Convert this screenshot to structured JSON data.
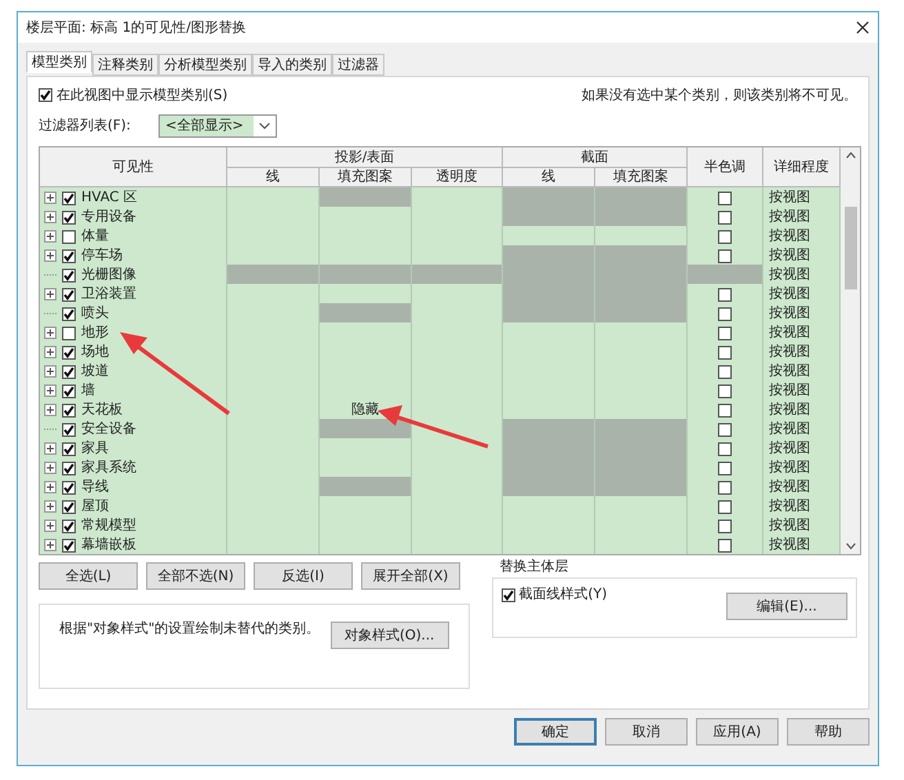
{
  "window": {
    "title": "楼层平面: 标高 1的可见性/图形替换"
  },
  "tabs": [
    {
      "label": "模型类别",
      "selected": true
    },
    {
      "label": "注释类别",
      "selected": false
    },
    {
      "label": "分析模型类别",
      "selected": false
    },
    {
      "label": "导入的类别",
      "selected": false
    },
    {
      "label": "过滤器",
      "selected": false
    }
  ],
  "show_categories": {
    "label": "在此视图中显示模型类别(S)",
    "checked": true
  },
  "hint": "如果没有选中某个类别，则该类别将不可见。",
  "filter": {
    "label": "过滤器列表(F):",
    "value": "<全部显示>"
  },
  "table": {
    "header": {
      "visibility": "可见性",
      "projection": "投影/表面",
      "cut": "截面",
      "halftone": "半色调",
      "detail": "详细程度",
      "projection_columns": [
        "线",
        "填充图案",
        "透明度"
      ],
      "cut_columns": [
        "线",
        "填充图案"
      ]
    },
    "rows": [
      {
        "name": "HVAC 区",
        "checked": true,
        "expandable": true,
        "cells": [
          {
            "disabled": false
          },
          {
            "disabled": true
          },
          {
            "disabled": false
          },
          {
            "disabled": true
          },
          {
            "disabled": true
          }
        ],
        "halftone": {
          "disabled": false,
          "checked": false
        },
        "detail": "按视图"
      },
      {
        "name": "专用设备",
        "checked": true,
        "expandable": true,
        "cells": [
          {
            "disabled": false
          },
          {
            "disabled": false
          },
          {
            "disabled": false
          },
          {
            "disabled": true
          },
          {
            "disabled": true
          }
        ],
        "halftone": {
          "disabled": false,
          "checked": false
        },
        "detail": "按视图"
      },
      {
        "name": "体量",
        "checked": false,
        "expandable": true,
        "cells": [
          {
            "disabled": false
          },
          {
            "disabled": false
          },
          {
            "disabled": false
          },
          {
            "disabled": false
          },
          {
            "disabled": false
          }
        ],
        "halftone": {
          "disabled": false,
          "checked": false
        },
        "detail": "按视图"
      },
      {
        "name": "停车场",
        "checked": true,
        "expandable": true,
        "cells": [
          {
            "disabled": false
          },
          {
            "disabled": false
          },
          {
            "disabled": false
          },
          {
            "disabled": true
          },
          {
            "disabled": true
          }
        ],
        "halftone": {
          "disabled": false,
          "checked": false
        },
        "detail": "按视图"
      },
      {
        "name": "光栅图像",
        "checked": true,
        "expandable": false,
        "cells": [
          {
            "disabled": true
          },
          {
            "disabled": true
          },
          {
            "disabled": true
          },
          {
            "disabled": true
          },
          {
            "disabled": true
          }
        ],
        "halftone": {
          "disabled": true
        },
        "detail": "按视图"
      },
      {
        "name": "卫浴装置",
        "checked": true,
        "expandable": true,
        "cells": [
          {
            "disabled": false
          },
          {
            "disabled": false
          },
          {
            "disabled": false
          },
          {
            "disabled": true
          },
          {
            "disabled": true
          }
        ],
        "halftone": {
          "disabled": false,
          "checked": false
        },
        "detail": "按视图"
      },
      {
        "name": "喷头",
        "checked": true,
        "expandable": false,
        "cells": [
          {
            "disabled": false
          },
          {
            "disabled": true
          },
          {
            "disabled": false
          },
          {
            "disabled": true
          },
          {
            "disabled": true
          }
        ],
        "halftone": {
          "disabled": false,
          "checked": false
        },
        "detail": "按视图"
      },
      {
        "name": "地形",
        "checked": false,
        "expandable": true,
        "cells": [
          {
            "disabled": false
          },
          {
            "disabled": false
          },
          {
            "disabled": false
          },
          {
            "disabled": false
          },
          {
            "disabled": false
          }
        ],
        "halftone": {
          "disabled": false,
          "checked": false
        },
        "detail": "按视图"
      },
      {
        "name": "场地",
        "checked": true,
        "expandable": true,
        "cells": [
          {
            "disabled": false
          },
          {
            "disabled": false
          },
          {
            "disabled": false
          },
          {
            "disabled": false
          },
          {
            "disabled": false
          }
        ],
        "halftone": {
          "disabled": false,
          "checked": false
        },
        "detail": "按视图"
      },
      {
        "name": "坡道",
        "checked": true,
        "expandable": true,
        "cells": [
          {
            "disabled": false
          },
          {
            "disabled": false
          },
          {
            "disabled": false
          },
          {
            "disabled": false
          },
          {
            "disabled": false
          }
        ],
        "halftone": {
          "disabled": false,
          "checked": false
        },
        "detail": "按视图"
      },
      {
        "name": "墙",
        "checked": true,
        "expandable": true,
        "cells": [
          {
            "disabled": false
          },
          {
            "disabled": false
          },
          {
            "disabled": false
          },
          {
            "disabled": false
          },
          {
            "disabled": false
          }
        ],
        "halftone": {
          "disabled": false,
          "checked": false
        },
        "detail": "按视图"
      },
      {
        "name": "天花板",
        "checked": true,
        "expandable": true,
        "cells": [
          {
            "disabled": false
          },
          {
            "disabled": false,
            "text": "隐藏"
          },
          {
            "disabled": false
          },
          {
            "disabled": false
          },
          {
            "disabled": false
          }
        ],
        "halftone": {
          "disabled": false,
          "checked": false
        },
        "detail": "按视图"
      },
      {
        "name": "安全设备",
        "checked": true,
        "expandable": false,
        "cells": [
          {
            "disabled": false
          },
          {
            "disabled": true
          },
          {
            "disabled": false
          },
          {
            "disabled": true
          },
          {
            "disabled": true
          }
        ],
        "halftone": {
          "disabled": false,
          "checked": false
        },
        "detail": "按视图"
      },
      {
        "name": "家具",
        "checked": true,
        "expandable": true,
        "cells": [
          {
            "disabled": false
          },
          {
            "disabled": false
          },
          {
            "disabled": false
          },
          {
            "disabled": true
          },
          {
            "disabled": true
          }
        ],
        "halftone": {
          "disabled": false,
          "checked": false
        },
        "detail": "按视图"
      },
      {
        "name": "家具系统",
        "checked": true,
        "expandable": true,
        "cells": [
          {
            "disabled": false
          },
          {
            "disabled": false
          },
          {
            "disabled": false
          },
          {
            "disabled": true
          },
          {
            "disabled": true
          }
        ],
        "halftone": {
          "disabled": false,
          "checked": false
        },
        "detail": "按视图"
      },
      {
        "name": "导线",
        "checked": true,
        "expandable": true,
        "cells": [
          {
            "disabled": false
          },
          {
            "disabled": true
          },
          {
            "disabled": false
          },
          {
            "disabled": true
          },
          {
            "disabled": true
          }
        ],
        "halftone": {
          "disabled": false,
          "checked": false
        },
        "detail": "按视图"
      },
      {
        "name": "屋顶",
        "checked": true,
        "expandable": true,
        "cells": [
          {
            "disabled": false
          },
          {
            "disabled": false
          },
          {
            "disabled": false
          },
          {
            "disabled": false
          },
          {
            "disabled": false
          }
        ],
        "halftone": {
          "disabled": false,
          "checked": false
        },
        "detail": "按视图"
      },
      {
        "name": "常规模型",
        "checked": true,
        "expandable": true,
        "cells": [
          {
            "disabled": false
          },
          {
            "disabled": false
          },
          {
            "disabled": false
          },
          {
            "disabled": false
          },
          {
            "disabled": false
          }
        ],
        "halftone": {
          "disabled": false,
          "checked": false
        },
        "detail": "按视图"
      },
      {
        "name": "幕墙嵌板",
        "checked": true,
        "expandable": true,
        "cells": [
          {
            "disabled": false
          },
          {
            "disabled": false
          },
          {
            "disabled": false
          },
          {
            "disabled": false
          },
          {
            "disabled": false
          }
        ],
        "halftone": {
          "disabled": false,
          "checked": false
        },
        "detail": "按视图"
      }
    ]
  },
  "table_buttons": [
    "全选(L)",
    "全部不选(N)",
    "反选(I)",
    "展开全部(X)"
  ],
  "object_styles": {
    "note": "根据\"对象样式\"的设置绘制未替代的类别。",
    "button": "对象样式(O)..."
  },
  "host_layers": {
    "title": "替换主体层",
    "checkbox": {
      "label": "截面线样式(Y)",
      "checked": true
    },
    "button": "编辑(E)..."
  },
  "footer_buttons": [
    {
      "label": "确定",
      "default": true
    },
    {
      "label": "取消",
      "default": false
    },
    {
      "label": "应用(A)",
      "default": false
    },
    {
      "label": "帮助",
      "default": false
    }
  ]
}
